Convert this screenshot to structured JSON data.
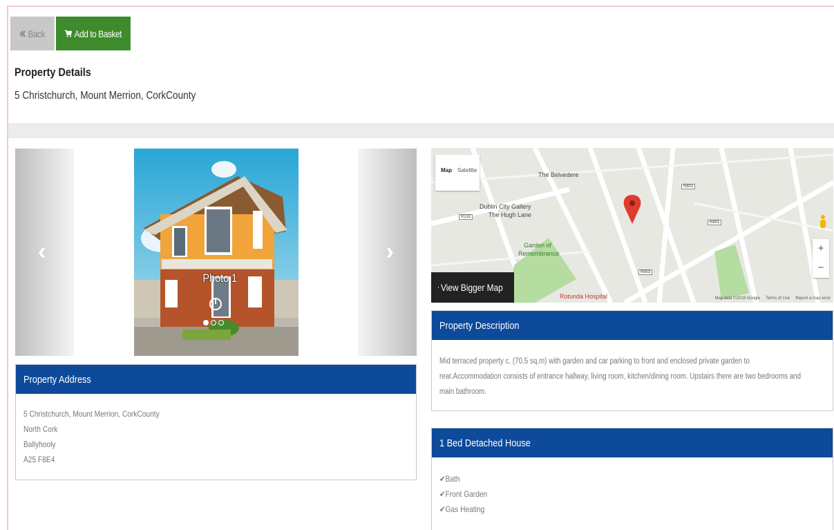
{
  "toolbar": {
    "back_label": "Back",
    "basket_label": "Add to Basket",
    "back_color": "#c8c8c8",
    "basket_color": "#3d8b2c"
  },
  "page": {
    "title": "Property Details",
    "address_line": "5 Christchurch, Mount Merrion, CorkCounty"
  },
  "gallery": {
    "caption": "Photo 1",
    "slide_count": 3,
    "active_slide": 1,
    "prev_icon": "chevron-left-icon",
    "next_icon": "chevron-right-icon"
  },
  "address_panel": {
    "title": "Property Address",
    "lines": [
      "5 Christchurch, Mount Merrion, CorkCounty",
      "North Cork",
      "Ballyhooly",
      "A25 F8E4"
    ]
  },
  "map": {
    "type_map": "Map",
    "type_satellite": "Satellite",
    "bigger_label": "View Bigger Map",
    "labels": {
      "belvedere": "The Belvedere",
      "gallery_1": "Dublin City Gallery",
      "gallery_2": "The Hugh Lane",
      "garden_1": "Garden of",
      "garden_2": "Remembrance",
      "rotunda": "Rotunda Hospital"
    },
    "footer": {
      "data": "Map data ©2018 Google",
      "terms": "Terms of Use",
      "report": "Report a map error"
    }
  },
  "description_panel": {
    "title": "Property Description",
    "line1": "Mid terraced property c. (70.5 sq.m) with garden and car parking to front and enclosed private garden to",
    "line2": "rear.Accommodation consists of entrance hallway, living room, kitchen/dining room. Upstairs there are two bedrooms and",
    "line3": "main bathroom."
  },
  "features_panel": {
    "title": "1 Bed Detached House",
    "features": [
      "Bath",
      "Front Garden",
      "Gas Heating"
    ]
  },
  "theme": {
    "panel_header": "#0d4a9a"
  }
}
